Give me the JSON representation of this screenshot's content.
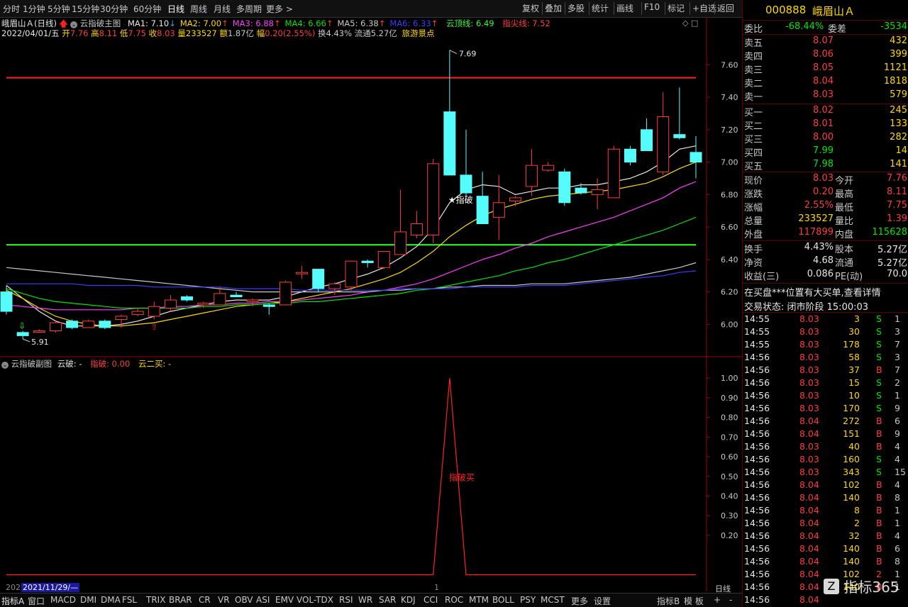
{
  "toolbar": {
    "periods": [
      "分时",
      "1分钟",
      "5分钟",
      "15分钟",
      "30分钟",
      "60分钟",
      "日线",
      "周线",
      "月线",
      "多周期",
      "更多 >"
    ],
    "active_period": "日线",
    "buttons": [
      "复权",
      "叠加",
      "多股",
      "统计",
      "画线",
      "F10",
      "标记",
      "+自选",
      "返回"
    ]
  },
  "header": {
    "stock_name": "峨眉山Ａ",
    "period": "(日线)",
    "indicator_name": "云指破主图",
    "ma": [
      {
        "label": "MA1: 7.10",
        "color": "#e6e6e6"
      },
      {
        "label": "MA2: 7.00",
        "color": "#ffd800"
      },
      {
        "label": "MA3: 6.88",
        "color": "#ff3cff"
      },
      {
        "label": "MA4: 6.66",
        "color": "#00e600"
      },
      {
        "label": "MA5: 6.38",
        "color": "#c8c8c8"
      },
      {
        "label": "MA6: 6.33",
        "color": "#3c3cff"
      }
    ],
    "cloud_top": "云顶线: 6.49",
    "peak_line": "指尖线: 7.52",
    "date": "2022/04/01/五",
    "open_lbl": "开",
    "open": "7.76",
    "high_lbl": "高",
    "high": "8.11",
    "low_lbl": "低",
    "low": "7.75",
    "close_lbl": "收",
    "close": "8.03",
    "vol_lbl": "量",
    "vol": "233527",
    "amt_lbl": "额",
    "amt": "1.87亿",
    "chg_lbl": "幅",
    "chg": "0.20(2.55%)",
    "turn_lbl": "换",
    "turn": "4.43%",
    "float_lbl": "流通",
    "float": "5.27亿",
    "sector": "旅游景点"
  },
  "chart_data": [
    {
      "type": "candlestick",
      "title": "云指破主图",
      "y_ticks": [
        "7.60",
        "7.40",
        "7.20",
        "7.00",
        "6.80",
        "6.60",
        "6.40",
        "6.20",
        "6.00"
      ],
      "ylim": [
        5.84,
        7.75
      ],
      "reference_lines": [
        {
          "name": "指尖线",
          "value": 7.52,
          "color": "#ff2020"
        },
        {
          "name": "云顶线",
          "value": 6.49,
          "color": "#30ff30"
        }
      ],
      "annotations": [
        {
          "text": "7.69",
          "value": 7.69
        },
        {
          "text": "5.91",
          "value": 5.91
        },
        {
          "text": "★指破",
          "value": 6.77
        }
      ],
      "candles": [
        {
          "o": 6.2,
          "h": 6.24,
          "l": 6.06,
          "c": 6.08
        },
        {
          "o": 5.95,
          "h": 5.96,
          "l": 5.91,
          "c": 5.93
        },
        {
          "o": 5.96,
          "h": 5.97,
          "l": 5.95,
          "c": 5.96
        },
        {
          "o": 5.96,
          "h": 6.02,
          "l": 5.95,
          "c": 6.01
        },
        {
          "o": 6.02,
          "h": 6.03,
          "l": 5.97,
          "c": 5.98
        },
        {
          "o": 5.98,
          "h": 6.03,
          "l": 5.98,
          "c": 6.02
        },
        {
          "o": 6.02,
          "h": 6.03,
          "l": 5.97,
          "c": 5.98
        },
        {
          "o": 6.03,
          "h": 6.06,
          "l": 5.98,
          "c": 6.05
        },
        {
          "o": 6.06,
          "h": 6.1,
          "l": 6.05,
          "c": 6.08
        },
        {
          "o": 6.05,
          "h": 6.14,
          "l": 6.03,
          "c": 6.11
        },
        {
          "o": 6.1,
          "h": 6.18,
          "l": 6.08,
          "c": 6.15
        },
        {
          "o": 6.17,
          "h": 6.18,
          "l": 6.14,
          "c": 6.15
        },
        {
          "o": 6.12,
          "h": 6.14,
          "l": 6.1,
          "c": 6.13
        },
        {
          "o": 6.12,
          "h": 6.23,
          "l": 6.12,
          "c": 6.19
        },
        {
          "o": 6.18,
          "h": 6.2,
          "l": 6.17,
          "c": 6.17
        },
        {
          "o": 6.14,
          "h": 6.16,
          "l": 6.11,
          "c": 6.15
        },
        {
          "o": 6.12,
          "h": 6.13,
          "l": 6.06,
          "c": 6.11
        },
        {
          "o": 6.12,
          "h": 6.27,
          "l": 6.12,
          "c": 6.26
        },
        {
          "o": 6.32,
          "h": 6.36,
          "l": 6.28,
          "c": 6.32
        },
        {
          "o": 6.34,
          "h": 6.34,
          "l": 6.2,
          "c": 6.22
        },
        {
          "o": 6.22,
          "h": 6.26,
          "l": 6.18,
          "c": 6.25
        },
        {
          "o": 6.23,
          "h": 6.39,
          "l": 6.21,
          "c": 6.39
        },
        {
          "o": 6.39,
          "h": 6.4,
          "l": 6.35,
          "c": 6.38
        },
        {
          "o": 6.35,
          "h": 6.45,
          "l": 6.34,
          "c": 6.45
        },
        {
          "o": 6.43,
          "h": 6.83,
          "l": 6.43,
          "c": 6.57
        },
        {
          "o": 6.55,
          "h": 6.7,
          "l": 6.53,
          "c": 6.62
        },
        {
          "o": 6.55,
          "h": 7.02,
          "l": 6.5,
          "c": 6.99
        },
        {
          "o": 7.31,
          "h": 7.69,
          "l": 6.92,
          "c": 6.92
        },
        {
          "o": 6.92,
          "h": 7.2,
          "l": 6.78,
          "c": 6.81
        },
        {
          "o": 6.79,
          "h": 6.94,
          "l": 6.62,
          "c": 6.62
        },
        {
          "o": 6.66,
          "h": 6.92,
          "l": 6.52,
          "c": 6.75
        },
        {
          "o": 6.76,
          "h": 6.79,
          "l": 6.73,
          "c": 6.78
        },
        {
          "o": 6.85,
          "h": 7.08,
          "l": 6.79,
          "c": 6.98
        },
        {
          "o": 6.95,
          "h": 7.0,
          "l": 6.94,
          "c": 6.98
        },
        {
          "o": 6.94,
          "h": 6.96,
          "l": 6.73,
          "c": 6.75
        },
        {
          "o": 6.84,
          "h": 6.87,
          "l": 6.8,
          "c": 6.81
        },
        {
          "o": 6.8,
          "h": 6.9,
          "l": 6.71,
          "c": 6.83
        },
        {
          "o": 6.78,
          "h": 7.1,
          "l": 6.78,
          "c": 7.08
        },
        {
          "o": 7.08,
          "h": 7.1,
          "l": 6.98,
          "c": 7.0
        },
        {
          "o": 7.2,
          "h": 7.27,
          "l": 7.07,
          "c": 7.07
        },
        {
          "o": 6.94,
          "h": 7.43,
          "l": 6.92,
          "c": 7.28
        },
        {
          "o": 7.17,
          "h": 7.46,
          "l": 7.14,
          "c": 7.15
        },
        {
          "o": 7.06,
          "h": 7.16,
          "l": 6.9,
          "c": 7.0
        }
      ],
      "ma_series": [
        {
          "name": "MA1",
          "color": "#e6e6e6",
          "values": [
            6.24,
            6.16,
            6.08,
            6.02,
            5.99,
            5.99,
            5.99,
            6.0,
            6.02,
            6.05,
            6.08,
            6.1,
            6.12,
            6.14,
            6.15,
            6.15,
            6.15,
            6.17,
            6.2,
            6.23,
            6.25,
            6.28,
            6.31,
            6.35,
            6.41,
            6.48,
            6.59,
            6.75,
            6.83,
            6.86,
            6.85,
            6.8,
            6.82,
            6.84,
            6.84,
            6.86,
            6.86,
            6.88,
            6.9,
            6.94,
            7.0,
            7.08,
            7.1
          ]
        },
        {
          "name": "MA2",
          "color": "#ffd800",
          "values": [
            6.21,
            6.16,
            6.1,
            6.05,
            6.02,
            6.0,
            5.99,
            5.99,
            6.0,
            6.01,
            6.03,
            6.05,
            6.07,
            6.09,
            6.11,
            6.12,
            6.13,
            6.14,
            6.16,
            6.18,
            6.2,
            6.22,
            6.25,
            6.28,
            6.32,
            6.38,
            6.45,
            6.54,
            6.61,
            6.67,
            6.71,
            6.74,
            6.77,
            6.79,
            6.8,
            6.81,
            6.82,
            6.83,
            6.85,
            6.87,
            6.91,
            6.96,
            7.0
          ]
        },
        {
          "name": "MA3",
          "color": "#ff3cff",
          "values": [
            6.12,
            6.11,
            6.1,
            6.09,
            6.09,
            6.09,
            6.09,
            6.09,
            6.1,
            6.1,
            6.11,
            6.11,
            6.12,
            6.12,
            6.13,
            6.13,
            6.14,
            6.14,
            6.15,
            6.16,
            6.17,
            6.18,
            6.2,
            6.21,
            6.23,
            6.25,
            6.28,
            6.32,
            6.36,
            6.4,
            6.43,
            6.47,
            6.5,
            6.54,
            6.57,
            6.6,
            6.63,
            6.66,
            6.7,
            6.74,
            6.78,
            6.84,
            6.88
          ]
        },
        {
          "name": "MA4",
          "color": "#00e600",
          "values": [
            6.22,
            6.19,
            6.16,
            6.14,
            6.13,
            6.12,
            6.11,
            6.1,
            6.1,
            6.1,
            6.1,
            6.1,
            6.11,
            6.11,
            6.12,
            6.12,
            6.13,
            6.13,
            6.14,
            6.14,
            6.15,
            6.16,
            6.17,
            6.18,
            6.19,
            6.21,
            6.22,
            6.24,
            6.26,
            6.28,
            6.3,
            6.33,
            6.35,
            6.38,
            6.4,
            6.43,
            6.46,
            6.49,
            6.52,
            6.55,
            6.58,
            6.62,
            6.66
          ]
        },
        {
          "name": "MA5",
          "color": "#c8c8c8",
          "values": [
            6.35,
            6.34,
            6.33,
            6.32,
            6.31,
            6.3,
            6.29,
            6.28,
            6.27,
            6.26,
            6.25,
            6.24,
            6.23,
            6.22,
            6.21,
            6.2,
            6.2,
            6.2,
            6.2,
            6.2,
            6.2,
            6.2,
            6.2,
            6.21,
            6.21,
            6.22,
            6.22,
            6.23,
            6.23,
            6.24,
            6.24,
            6.24,
            6.25,
            6.25,
            6.25,
            6.26,
            6.27,
            6.28,
            6.29,
            6.31,
            6.33,
            6.35,
            6.38
          ]
        },
        {
          "name": "MA6",
          "color": "#3c3cff",
          "values": [
            6.25,
            6.25,
            6.25,
            6.25,
            6.25,
            6.24,
            6.24,
            6.24,
            6.24,
            6.23,
            6.23,
            6.23,
            6.23,
            6.23,
            6.22,
            6.22,
            6.22,
            6.22,
            6.21,
            6.21,
            6.21,
            6.21,
            6.21,
            6.21,
            6.22,
            6.22,
            6.22,
            6.22,
            6.23,
            6.23,
            6.23,
            6.23,
            6.24,
            6.24,
            6.24,
            6.25,
            6.26,
            6.27,
            6.28,
            6.29,
            6.3,
            6.32,
            6.33
          ]
        }
      ]
    },
    {
      "type": "line",
      "title": "云指破副图",
      "y_ticks": [
        "1.00",
        "0.90",
        "0.80",
        "0.70",
        "0.60",
        "0.50",
        "0.40",
        "0.30",
        "0.20"
      ],
      "ylim": [
        -0.02,
        1.04
      ],
      "series": [
        {
          "name": "指破",
          "color": "#ff2020",
          "values": [
            0,
            0,
            0,
            0,
            0,
            0,
            0,
            0,
            0,
            0,
            0,
            0,
            0,
            0,
            0,
            0,
            0,
            0,
            0,
            0,
            0,
            0,
            0,
            0,
            0,
            0,
            0,
            1,
            0,
            0,
            0,
            0,
            0,
            0,
            0,
            0,
            0,
            0,
            0,
            0,
            0,
            0,
            0
          ]
        }
      ],
      "annotation": "指破买"
    }
  ],
  "subchart_header": {
    "title": "云指破副图",
    "cloud_break": "云破: -",
    "break": "指破: 0.00",
    "cloud_buy": "云二买: -"
  },
  "xaxis": {
    "left_label": "202",
    "date_label": "2021/11/29/—",
    "month_marker": "1",
    "right_label": "日线"
  },
  "bottom_tabs": [
    "指标A",
    "窗口",
    "MACD",
    "DMI",
    "DMA",
    "FSL",
    "TRIX",
    "BRAR",
    "CR",
    "VR",
    "OBV",
    "ASI",
    "EMV",
    "VOL-TDX",
    "RSI",
    "WR",
    "SAR",
    "KDJ",
    "CCI",
    "ROC",
    "MTM",
    "BOLL",
    "PSY",
    "MCST",
    "更多",
    "设置"
  ],
  "bottom_right": [
    "指标B",
    "模 板",
    "+",
    "-"
  ],
  "quote": {
    "code": "000888",
    "name": "峨眉山Ａ",
    "weibi_lbl": "委比",
    "weibi": "-68.44%",
    "weicha_lbl": "委差",
    "weicha": "-3534",
    "asks": [
      {
        "label": "卖五",
        "price": "8.07",
        "vol": "432"
      },
      {
        "label": "卖四",
        "price": "8.06",
        "vol": "399"
      },
      {
        "label": "卖三",
        "price": "8.05",
        "vol": "1121"
      },
      {
        "label": "卖二",
        "price": "8.04",
        "vol": "1818"
      },
      {
        "label": "卖一",
        "price": "8.03",
        "vol": "579"
      }
    ],
    "bids": [
      {
        "label": "买一",
        "price": "8.02",
        "vol": "245"
      },
      {
        "label": "买二",
        "price": "8.01",
        "vol": "133"
      },
      {
        "label": "买三",
        "price": "8.00",
        "vol": "282"
      },
      {
        "label": "买四",
        "price": "7.99",
        "vol": "14"
      },
      {
        "label": "买五",
        "price": "7.98",
        "vol": "141"
      }
    ],
    "stats": [
      {
        "l1": "现价",
        "v1": "8.03",
        "c1": "red",
        "l2": "今开",
        "v2": "7.76",
        "c2": "red"
      },
      {
        "l1": "涨跌",
        "v1": "0.20",
        "c1": "red",
        "l2": "最高",
        "v2": "8.11",
        "c2": "red"
      },
      {
        "l1": "涨幅",
        "v1": "2.55%",
        "c1": "red",
        "l2": "最低",
        "v2": "7.75",
        "c2": "red"
      },
      {
        "l1": "总量",
        "v1": "233527",
        "c1": "yellow",
        "l2": "量比",
        "v2": "1.39",
        "c2": "red"
      },
      {
        "l1": "外盘",
        "v1": "117899",
        "c1": "red",
        "l2": "内盘",
        "v2": "115628",
        "c2": "green"
      }
    ],
    "stats2": [
      {
        "l1": "换手",
        "v1": "4.43%",
        "l2": "股本",
        "v2": "5.27亿"
      },
      {
        "l1": "净资",
        "v1": "4.68",
        "l2": "流通",
        "v2": "5.27亿"
      },
      {
        "l1": "收益(三)",
        "v1": "0.086",
        "l2": "PE(动)",
        "v2": "70.0"
      }
    ],
    "notice": "在买盘***位置有大买单,查看详情",
    "trade_status": "交易状态: 闭市阶段 15:00:03"
  },
  "ticks": [
    {
      "t": "14:55",
      "p": "8.03",
      "v": "3",
      "bs": "S",
      "n": "1"
    },
    {
      "t": "14:55",
      "p": "8.03",
      "v": "30",
      "bs": "S",
      "n": "3"
    },
    {
      "t": "14:55",
      "p": "8.03",
      "v": "178",
      "bs": "S",
      "n": "7"
    },
    {
      "t": "14:56",
      "p": "8.03",
      "v": "58",
      "bs": "S",
      "n": "3"
    },
    {
      "t": "14:56",
      "p": "8.03",
      "v": "37",
      "bs": "B",
      "n": "7"
    },
    {
      "t": "14:56",
      "p": "8.03",
      "v": "15",
      "bs": "S",
      "n": "2"
    },
    {
      "t": "14:56",
      "p": "8.03",
      "v": "10",
      "bs": "S",
      "n": "1"
    },
    {
      "t": "14:56",
      "p": "8.03",
      "v": "170",
      "bs": "S",
      "n": "9"
    },
    {
      "t": "14:56",
      "p": "8.04",
      "v": "272",
      "bs": "B",
      "n": "6"
    },
    {
      "t": "14:56",
      "p": "8.04",
      "v": "151",
      "bs": "B",
      "n": "9"
    },
    {
      "t": "14:56",
      "p": "8.03",
      "v": "40",
      "bs": "B",
      "n": "4"
    },
    {
      "t": "14:56",
      "p": "8.03",
      "v": "160",
      "bs": "S",
      "n": "4"
    },
    {
      "t": "14:56",
      "p": "8.03",
      "v": "343",
      "bs": "S",
      "n": "15"
    },
    {
      "t": "14:56",
      "p": "8.04",
      "v": "102",
      "bs": "B",
      "n": "4"
    },
    {
      "t": "14:56",
      "p": "8.04",
      "v": "140",
      "bs": "B",
      "n": "8"
    },
    {
      "t": "14:56",
      "p": "8.04",
      "v": "8",
      "bs": "B",
      "n": "1"
    },
    {
      "t": "14:56",
      "p": "8.04",
      "v": "2",
      "bs": "B",
      "n": "1"
    },
    {
      "t": "14:56",
      "p": "8.04",
      "v": "32",
      "bs": "B",
      "n": "4"
    },
    {
      "t": "14:56",
      "p": "8.04",
      "v": "140",
      "bs": "B",
      "n": "6"
    },
    {
      "t": "14:56",
      "p": "8.04",
      "v": "140",
      "bs": "B",
      "n": "8"
    },
    {
      "t": "14:56",
      "p": "8.04",
      "v": "102",
      "bs": "2",
      "n": "1"
    },
    {
      "t": "14:56",
      "p": "8.04",
      "v": "140",
      "bs": "B",
      "n": "1"
    },
    {
      "t": "14:56",
      "p": "8.04",
      "v": "",
      "bs": "",
      "n": ""
    }
  ],
  "watermark": "指标365",
  "colors": {
    "up": "#ff3c3c",
    "down": "#54fcfc",
    "peak_line": "#ff2020",
    "cloud_line": "#30ff30",
    "axis": "#a00000"
  }
}
